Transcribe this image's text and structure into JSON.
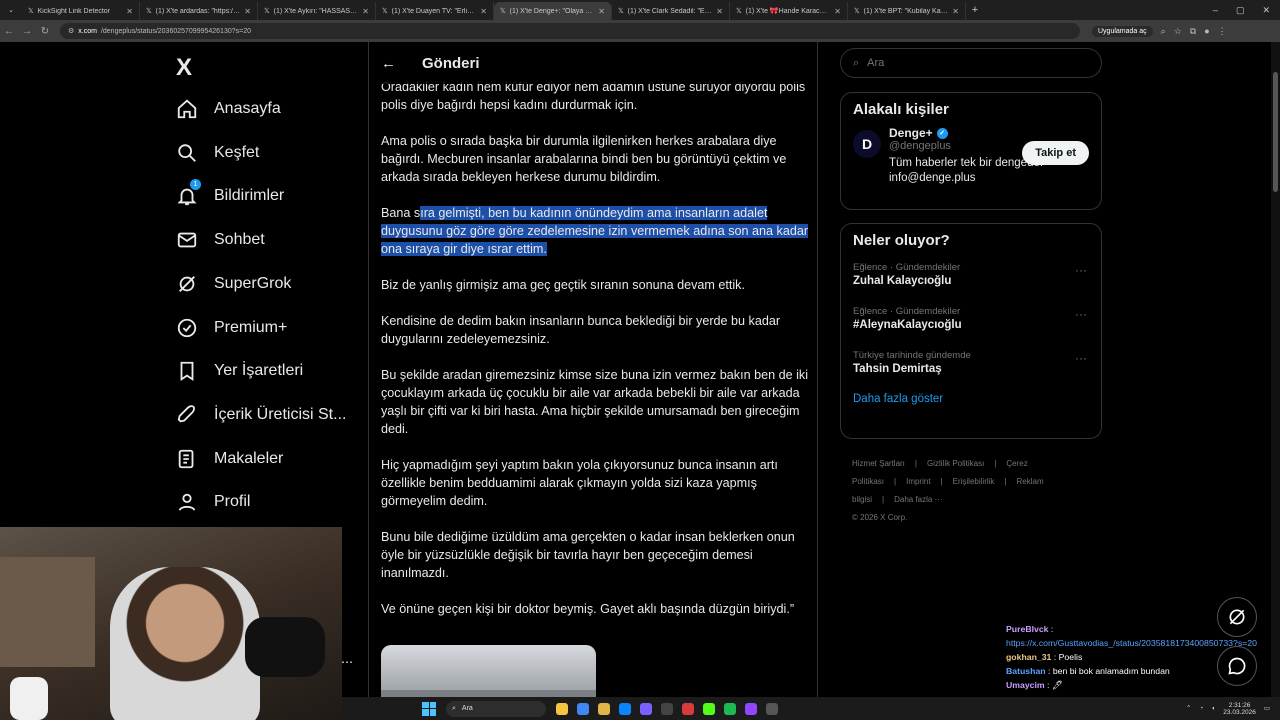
{
  "browser": {
    "tabs": [
      {
        "title": "KickSight Link Detector",
        "active": false
      },
      {
        "title": "(1) X'te ardardas: \"https://t.co/...",
        "active": false
      },
      {
        "title": "(1) X'te Aykırı: \"HASSAS / Şoke...",
        "active": false
      },
      {
        "title": "(1) X'te Duayen TV: \"Erlik: Nevı...",
        "active": false
      },
      {
        "title": "(1) X'te Denge+: \"Olaya şahit ol...",
        "active": true
      },
      {
        "title": "(1) X'te Clark Sedadil: \"Emniyet...",
        "active": false
      },
      {
        "title": "(1) X'te 🎀Hande Karacasu: \"Ya...",
        "active": false
      },
      {
        "title": "(1) X'te BPT: \"Kubilay Kaan Kur...",
        "active": false
      }
    ],
    "url_host": "x.com",
    "url_path": "/dengeplus/status/2036025709995426130?s=20",
    "app_pill": "Uygulamada aç"
  },
  "sidebar": {
    "logo": "X",
    "items": [
      {
        "label": "Anasayfa",
        "icon": "home-icon"
      },
      {
        "label": "Keşfet",
        "icon": "search-icon"
      },
      {
        "label": "Bildirimler",
        "icon": "bell-icon",
        "badge": "1"
      },
      {
        "label": "Sohbet",
        "icon": "mail-icon"
      },
      {
        "label": "SuperGrok",
        "icon": "grok-icon"
      },
      {
        "label": "Premium+",
        "icon": "verified-icon"
      },
      {
        "label": "Yer İşaretleri",
        "icon": "bookmark-icon"
      },
      {
        "label": "İçerik Üreticisi St...",
        "icon": "rocket-icon"
      },
      {
        "label": "Makaleler",
        "icon": "article-icon"
      },
      {
        "label": "Profil",
        "icon": "person-icon"
      }
    ]
  },
  "main": {
    "header_title": "Gönderi",
    "paragraphs": [
      "Oradakiler kadın hem küfür ediyor hem adamın üstüne sürüyor diyordu polis polis diye bağırdı hepsi kadını durdurmak için.",
      "Ama polis o sırada başka bir durumla ilgilenirken herkes arabalara diye bağırdı. Mecburen insanlar arabalarına bindi ben bu görüntüyü çektim ve arkada sırada bekleyen herkese durumu bildirdim."
    ],
    "selected_paragraph": {
      "before": "Bana s",
      "selected": "ıra gelmişti, ben bu kadının önündeydim ama insanların adalet duygusunu göz göre göre zedelemesine izin vermemek adına son ana kadar ona sıraya gir diye ısrar ettim."
    },
    "paragraphs_after": [
      "Biz de yanlış girmişiz ama geç geçtik sıranın sonuna devam ettik.",
      "Kendisine de dedim bakın insanların bunca beklediği bir yerde bu kadar duygularını zedeleyemezsiniz.",
      "Bu şekilde aradan giremezsiniz kimse size buna izin vermez bakın ben de iki çocuklayım arkada üç çocuklu bir aile var arkada bebekli bir aile var arkada yaşlı bir çifti var ki biri hasta. Ama hiçbir şekilde umursamadı ben gireceğim dedi.",
      "Hiç yapmadığım şeyi yaptım bakın yola çıkıyorsunuz bunca insanın artı özellikle benim bedduamimi alarak çıkmayın yolda sizi kaza yapmış görmeyelim dedim.",
      "Bunu bile dediğime üzüldüm ama gerçekten o kadar insan beklerken onun öyle bir yüzsüzlükle değişik bir tavırla hayır ben geçeceğim demesi inanılmazdı.",
      "Ve önüne geçen kişi bir doktor beymiş. Gayet aklı başında düzgün biriydi.”"
    ]
  },
  "right": {
    "search_placeholder": "Ara",
    "related_title": "Alakalı kişiler",
    "account": {
      "name": "Denge+",
      "handle": "@dengeplus",
      "bio_line1": "Tüm haberler tek bir dengede.",
      "bio_line2": "info@denge.plus",
      "follow_label": "Takip et",
      "avatar_letter": "D"
    },
    "trends_title": "Neler oluyor?",
    "trends": [
      {
        "category": "Eğlence · Gündemdekiler",
        "title": "Zuhal Kalaycıoğlu"
      },
      {
        "category": "Eğlence · Gündemdekiler",
        "title": "#AleynaKalaycıoğlu"
      },
      {
        "category": "Türkiye tarihinde gündemde",
        "title": "Tahsin Demirtaş"
      }
    ],
    "show_more": "Daha fazla göster",
    "footer_links": [
      "Hizmet Şartları",
      "Gizlilik Politikası",
      "Çerez Politikası",
      "Imprint",
      "Erişilebilirlik",
      "Reklam bilgisi",
      "Daha fazla ···"
    ],
    "copyright": "© 2026 X Corp."
  },
  "chat": [
    {
      "user": "PureBlvck",
      "text": "https://x.com/Gusttavodias_/status/2035818173400850733?s=20"
    },
    {
      "user": "gokhan_31",
      "text": "Poelis"
    },
    {
      "user": "Batushan",
      "text": "ben bi bok anlamadım bundan"
    },
    {
      "user": "Umaycim",
      "text": "🖊"
    }
  ],
  "taskbar": {
    "search_placeholder": "Ara",
    "time": "2:31:26",
    "date": "23.03.2026"
  },
  "colors": {
    "accent": "#1d9bf0",
    "selection": "#1d4fa8",
    "background": "#000000"
  }
}
